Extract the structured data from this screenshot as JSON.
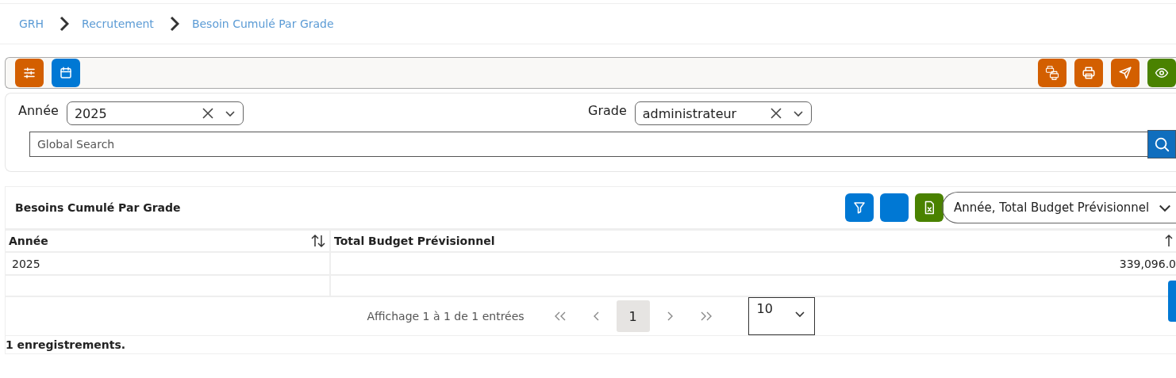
{
  "breadcrumb": [
    "GRH",
    "Recrutement",
    "Besoin Cumulé Par Grade"
  ],
  "toolbar": {
    "left": [
      {
        "kind": "sliders",
        "color": "#d35f00"
      },
      {
        "kind": "calendar",
        "color": "#0078d4"
      }
    ],
    "right": [
      {
        "kind": "printers",
        "color": "#d35f00"
      },
      {
        "kind": "printer",
        "color": "#d35f00"
      },
      {
        "kind": "send",
        "color": "#d35f00"
      },
      {
        "kind": "eye",
        "color": "#4a8200"
      }
    ]
  },
  "filters": [
    {
      "label": "Année",
      "value": "2025"
    },
    {
      "label": "Grade",
      "value": "administrateur"
    }
  ],
  "search": {
    "placeholder": "Global Search"
  },
  "grid": {
    "title": "Besoins Cumulé Par Grade",
    "tools": [
      {
        "kind": "filter",
        "color": "#0078d4"
      },
      {
        "kind": "blank",
        "color": "#0078d4"
      },
      {
        "kind": "excel",
        "color": "#4a8200"
      }
    ],
    "column_chooser": "Année, Total Budget Prévisionnel",
    "columns": [
      {
        "label": "Année",
        "kind": "sortable"
      },
      {
        "label": "Total Budget Prévisionnel",
        "kind": "ascending"
      }
    ],
    "rows": [
      [
        "2025",
        "339,096.0"
      ]
    ],
    "summary": "Affichage 1 à 1 de 1 entrées",
    "pages": [
      {
        "label": "1",
        "selected": true
      }
    ],
    "page_size": "10",
    "footer": "1 enregistrements."
  }
}
